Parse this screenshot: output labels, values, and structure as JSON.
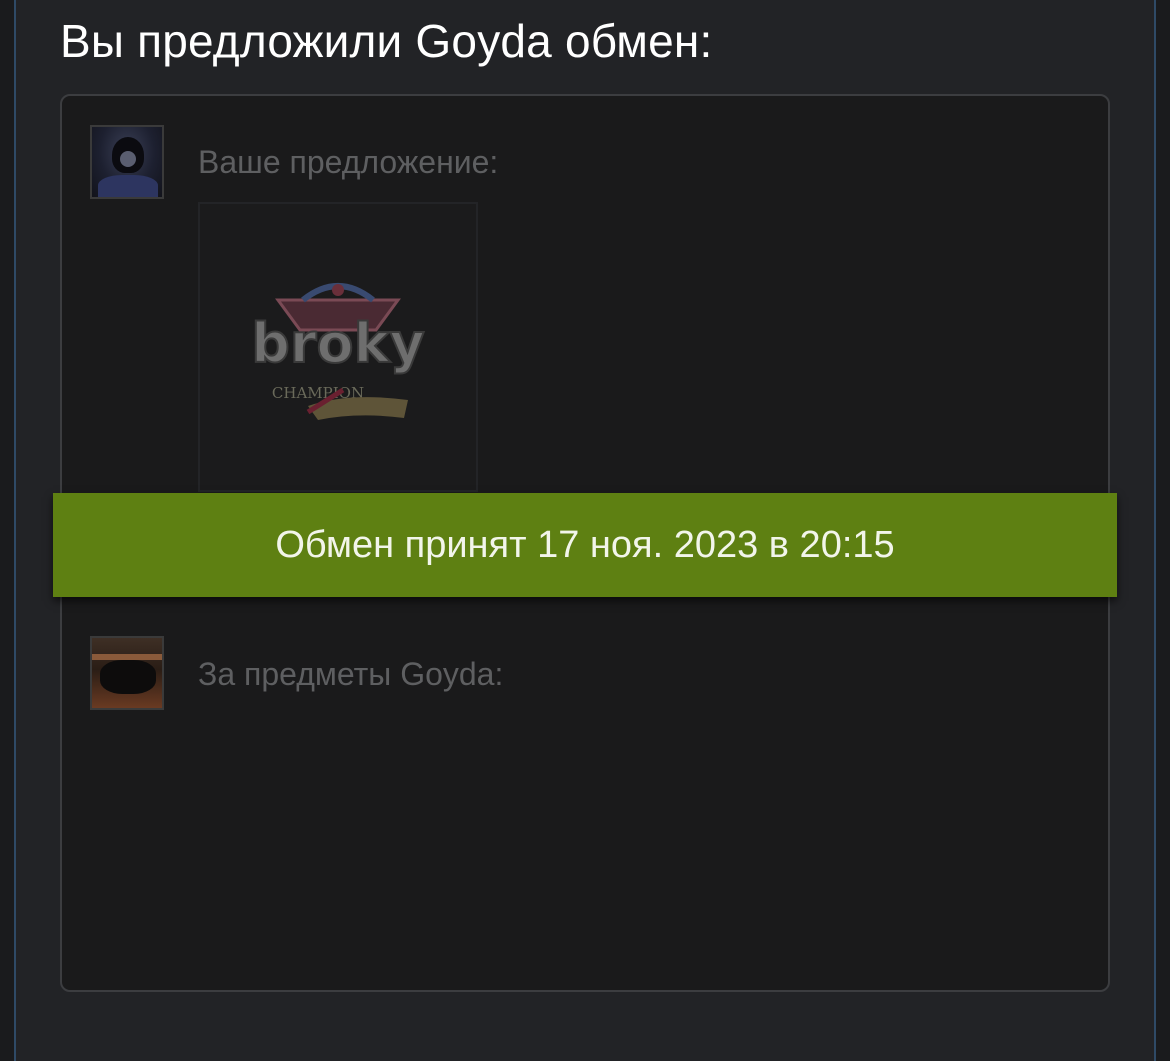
{
  "header": {
    "title": "Вы предложили Goyda обмен:"
  },
  "offer": {
    "your_offer_label": "Ваше предложение:",
    "their_items_label": "За предметы Goyda:",
    "item": {
      "name_text": "broky",
      "subtitle_text": "CHAMPION"
    }
  },
  "status": {
    "accepted_text": "Обмен принят 17 ноя. 2023 в 20:15",
    "bar_color": "#5e8012"
  }
}
